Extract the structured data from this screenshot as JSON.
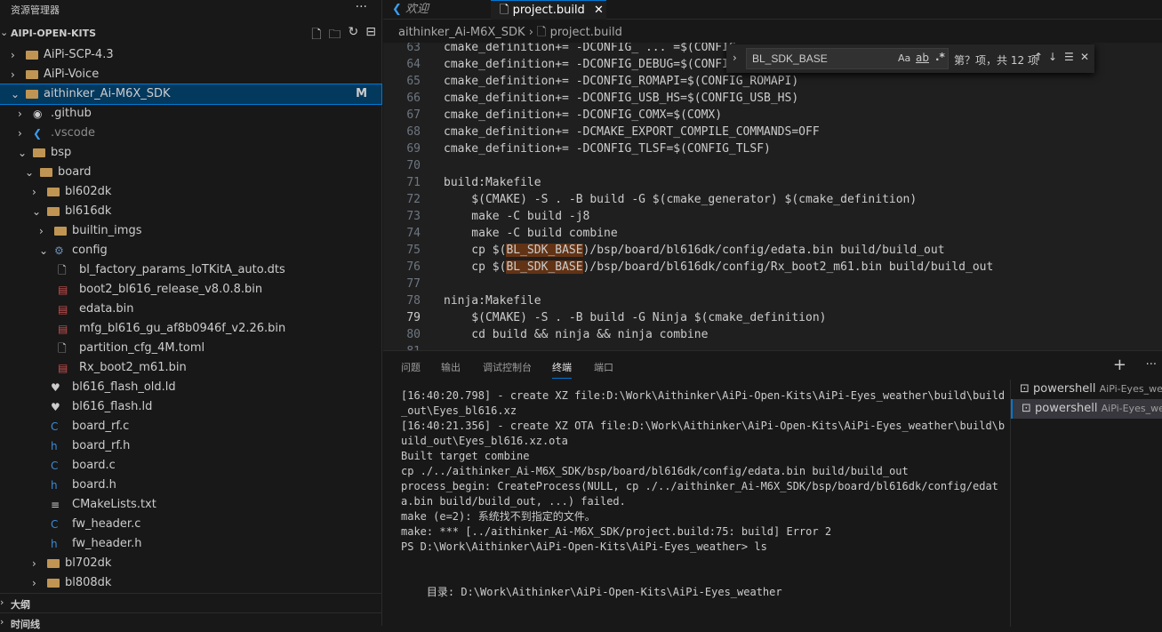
{
  "sidebar": {
    "title": "资源管理器",
    "more": "···",
    "section": "AIPI-OPEN-KITS",
    "actions": [
      "new-file",
      "new-folder",
      "refresh",
      "collapse"
    ],
    "items": [
      {
        "label": "AiPi-SCP-4.3",
        "level": 0,
        "type": "folder",
        "open": false
      },
      {
        "label": "AiPi-Voice",
        "level": 0,
        "type": "folder",
        "open": false
      },
      {
        "label": "aithinker_Ai-M6X_SDK",
        "level": 0,
        "type": "folder",
        "open": true,
        "badge": "M",
        "selected": true
      },
      {
        "label": ".github",
        "level": 1,
        "type": "github",
        "open": false
      },
      {
        "label": ".vscode",
        "level": 1,
        "type": "vscode",
        "open": false,
        "dim": true
      },
      {
        "label": "bsp",
        "level": 1,
        "type": "folder",
        "open": true
      },
      {
        "label": "board",
        "level": 2,
        "type": "folder",
        "open": true
      },
      {
        "label": "bl602dk",
        "level": 3,
        "type": "folder",
        "open": false
      },
      {
        "label": "bl616dk",
        "level": 3,
        "type": "folder",
        "open": true
      },
      {
        "label": "builtin_imgs",
        "level": 4,
        "type": "folder",
        "open": false
      },
      {
        "label": "config",
        "level": 4,
        "type": "config",
        "open": true
      },
      {
        "label": "bl_factory_params_IoTKitA_auto.dts",
        "level": 5,
        "type": "file"
      },
      {
        "label": "boot2_bl616_release_v8.0.8.bin",
        "level": 5,
        "type": "bin"
      },
      {
        "label": "edata.bin",
        "level": 5,
        "type": "bin"
      },
      {
        "label": "mfg_bl616_gu_af8b0946f_v2.26.bin",
        "level": 5,
        "type": "bin"
      },
      {
        "label": "partition_cfg_4M.toml",
        "level": 5,
        "type": "file"
      },
      {
        "label": "Rx_boot2_m61.bin",
        "level": 5,
        "type": "bin"
      },
      {
        "label": "bl616_flash_old.ld",
        "level": 4,
        "type": "ld"
      },
      {
        "label": "bl616_flash.ld",
        "level": 4,
        "type": "ld"
      },
      {
        "label": "board_rf.c",
        "level": 4,
        "type": "c"
      },
      {
        "label": "board_rf.h",
        "level": 4,
        "type": "h"
      },
      {
        "label": "board.c",
        "level": 4,
        "type": "c"
      },
      {
        "label": "board.h",
        "level": 4,
        "type": "h"
      },
      {
        "label": "CMakeLists.txt",
        "level": 4,
        "type": "txt"
      },
      {
        "label": "fw_header.c",
        "level": 4,
        "type": "c"
      },
      {
        "label": "fw_header.h",
        "level": 4,
        "type": "h"
      },
      {
        "label": "bl702dk",
        "level": 3,
        "type": "folder",
        "open": false
      },
      {
        "label": "bl808dk",
        "level": 3,
        "type": "folder",
        "open": false
      }
    ],
    "outline": "大纲",
    "timeline": "时间线"
  },
  "tabs": [
    {
      "label": "欢迎",
      "active": false
    },
    {
      "label": "project.build",
      "active": true
    }
  ],
  "breadcrumb": {
    "folder": "aithinker_Ai-M6X_SDK",
    "file": "project.build"
  },
  "find": {
    "value": "BL_SDK_BASE",
    "match_case": "Aa",
    "whole_word": "ab",
    "regex": ".*",
    "result": "第？项，共 12 项"
  },
  "code": [
    {
      "n": "63",
      "t": "cmake_definition+= -DCONFIG_ ... =$(CONFIG_ ..."
    },
    {
      "n": "64",
      "t": "cmake_definition+= -DCONFIG_DEBUG=$(CONFIG_DEBUG)"
    },
    {
      "n": "65",
      "t": "cmake_definition+= -DCONFIG_ROMAPI=$(CONFIG_ROMAPI)"
    },
    {
      "n": "66",
      "t": "cmake_definition+= -DCONFIG_USB_HS=$(CONFIG_USB_HS)"
    },
    {
      "n": "67",
      "t": "cmake_definition+= -DCONFIG_COMX=$(COMX)"
    },
    {
      "n": "68",
      "t": "cmake_definition+= -DCMAKE_EXPORT_COMPILE_COMMANDS=OFF"
    },
    {
      "n": "69",
      "t": "cmake_definition+= -DCONFIG_TLSF=$(CONFIG_TLSF)"
    },
    {
      "n": "70",
      "t": ""
    },
    {
      "n": "71",
      "t": "build:Makefile"
    },
    {
      "n": "72",
      "t": "    $(CMAKE) -S . -B build -G $(cmake_generator) $(cmake_definition)"
    },
    {
      "n": "73",
      "t": "    make -C build -j8"
    },
    {
      "n": "74",
      "t": "    make -C build combine"
    },
    {
      "n": "75",
      "t": "    cp $(BL_SDK_BASE)/bsp/board/bl616dk/config/edata.bin build/build_out"
    },
    {
      "n": "76",
      "t": "    cp $(BL_SDK_BASE)/bsp/board/bl616dk/config/Rx_boot2_m61.bin build/build_out"
    },
    {
      "n": "77",
      "t": ""
    },
    {
      "n": "78",
      "t": "ninja:Makefile"
    },
    {
      "n": "79",
      "t": "    $(CMAKE) -S . -B build -G Ninja $(cmake_definition)"
    },
    {
      "n": "80",
      "t": "    cd build && ninja && ninja combine"
    },
    {
      "n": "81",
      "t": ""
    }
  ],
  "panel": {
    "tabs": [
      "问题",
      "输出",
      "调试控制台",
      "终端",
      "端口"
    ],
    "active": "终端",
    "add": "+",
    "more": "···",
    "terminal": [
      "[16:40:20.798] - create XZ file:D:\\Work\\Aithinker\\AiPi-Open-Kits\\AiPi-Eyes_weather\\build\\build_out\\Eyes_bl616.xz",
      "[16:40:21.356] - create XZ OTA file:D:\\Work\\Aithinker\\AiPi-Open-Kits\\AiPi-Eyes_weather\\build\\build_out\\Eyes_bl616.xz.ota",
      "Built target combine",
      "cp ./../aithinker_Ai-M6X_SDK/bsp/board/bl616dk/config/edata.bin build/build_out",
      "process_begin: CreateProcess(NULL, cp ./../aithinker_Ai-M6X_SDK/bsp/board/bl616dk/config/edata.bin build/build_out, ...) failed.",
      "make (e=2): 系统找不到指定的文件。",
      "make: *** [../aithinker_Ai-M6X_SDK/project.build:75: build] Error 2",
      "PS D:\\Work\\Aithinker\\AiPi-Open-Kits\\AiPi-Eyes_weather> ls",
      "",
      "",
      "    目录: D:\\Work\\Aithinker\\AiPi-Open-Kits\\AiPi-Eyes_weather"
    ],
    "sessions": [
      {
        "name": "powershell",
        "cwd": "AiPi-Eyes_weather"
      },
      {
        "name": "powershell",
        "cwd": "AiPi-Eyes_weather",
        "selected": true
      }
    ]
  },
  "colors": {
    "accent": "#0078d4",
    "selection": "#04395e",
    "find_highlight": "#623315",
    "folder": "#c09553"
  }
}
